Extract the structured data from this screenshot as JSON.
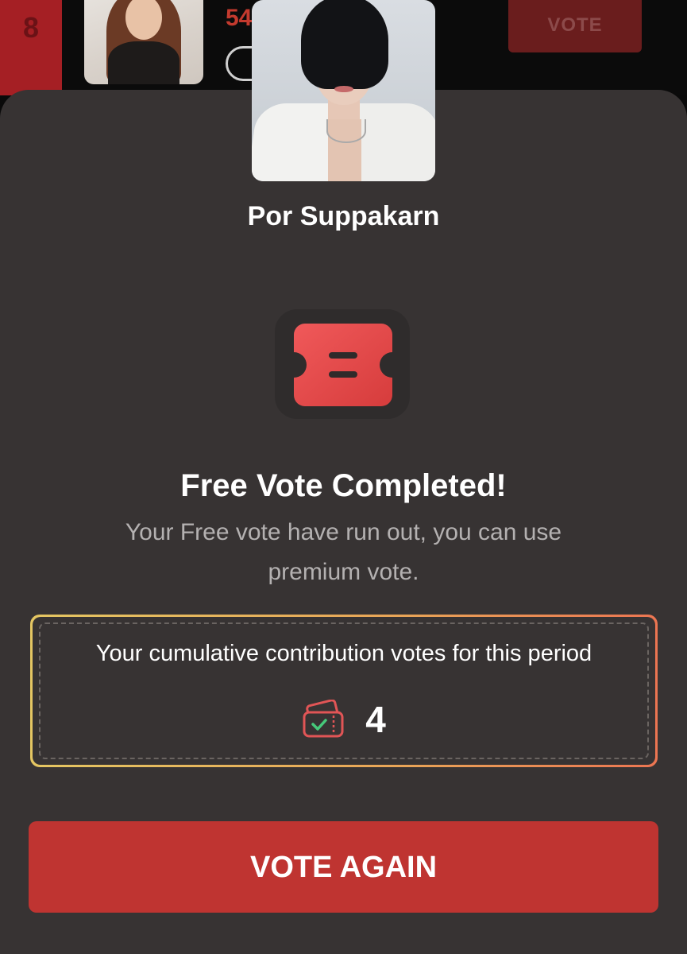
{
  "background_row": {
    "rank": "8",
    "score_partial": "54",
    "vote_label": "VOTE"
  },
  "modal": {
    "candidate_name": "Por Suppakarn",
    "title": "Free Vote Completed!",
    "message": "Your Free vote have run out, you can use premium vote.",
    "contribution": {
      "label": "Your cumulative contribution votes for this period",
      "count": "4"
    },
    "vote_again_label": "VOTE AGAIN"
  },
  "icons": {
    "ticket": "ticket-icon",
    "wallet": "wallet-check-icon"
  },
  "colors": {
    "accent_red": "#bf3431",
    "modal_bg": "#373333",
    "gradient_start": "#e4c662",
    "gradient_end": "#ec7552"
  }
}
